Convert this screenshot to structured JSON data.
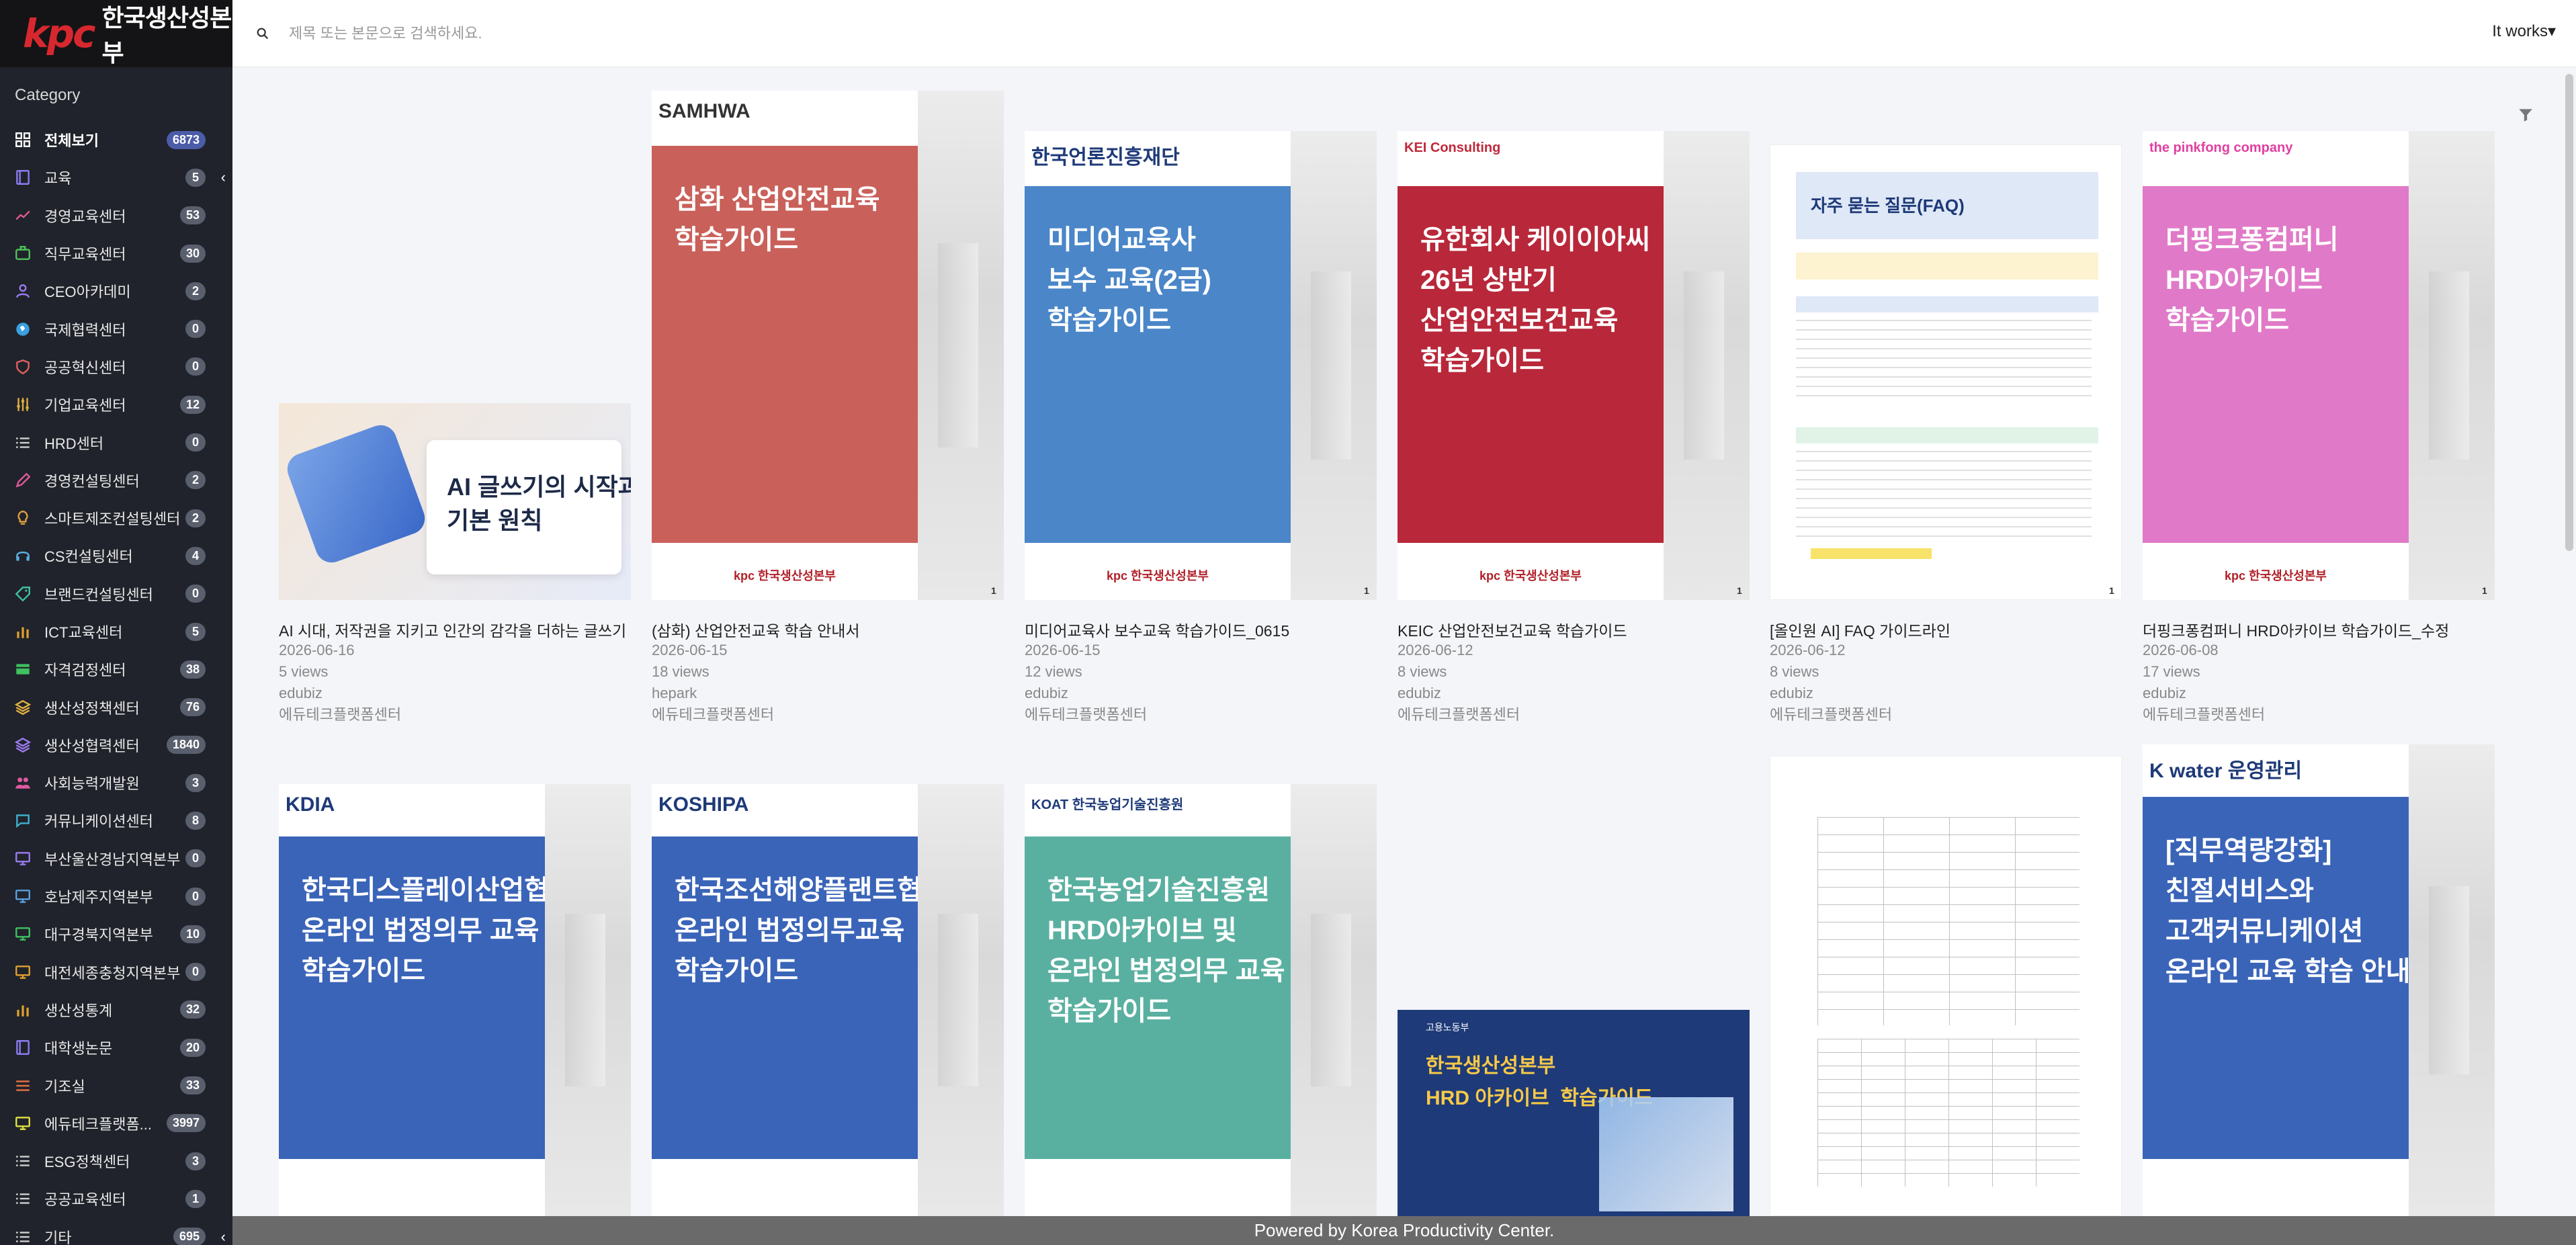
{
  "brand": {
    "mark": "kpc",
    "name": "한국생산성본부"
  },
  "sidebar": {
    "category_title": "Category",
    "items": [
      {
        "label": "전체보기",
        "count": "6873",
        "icon": "grid-icon",
        "color": "#ffffff"
      },
      {
        "label": "교육",
        "count": "5",
        "icon": "book-icon",
        "color": "#8a7cf0"
      },
      {
        "label": "경영교육센터",
        "count": "53",
        "icon": "chart-line-icon",
        "color": "#e05a8a"
      },
      {
        "label": "직무교육센터",
        "count": "30",
        "icon": "briefcase-icon",
        "color": "#4ec25a"
      },
      {
        "label": "CEO아카데미",
        "count": "2",
        "icon": "user-icon",
        "color": "#9a7cf0"
      },
      {
        "label": "국제협력센터",
        "count": "0",
        "icon": "globe-icon",
        "color": "#3aa0e0"
      },
      {
        "label": "공공혁신센터",
        "count": "0",
        "icon": "shield-icon",
        "color": "#e06060"
      },
      {
        "label": "기업교육센터",
        "count": "12",
        "icon": "sliders-icon",
        "color": "#e0b040"
      },
      {
        "label": "HRD센터",
        "count": "0",
        "icon": "list-icon",
        "color": "#d0d0d0"
      },
      {
        "label": "경영컨설팅센터",
        "count": "2",
        "icon": "pen-icon",
        "color": "#e05a9a"
      },
      {
        "label": "스마트제조컨설팅센터",
        "count": "2",
        "icon": "bulb-icon",
        "color": "#e0a040"
      },
      {
        "label": "CS컨설팅센터",
        "count": "4",
        "icon": "headset-icon",
        "color": "#5ab0e0"
      },
      {
        "label": "브랜드컨설팅센터",
        "count": "0",
        "icon": "tag-icon",
        "color": "#40c0a0"
      },
      {
        "label": "ICT교육센터",
        "count": "5",
        "icon": "bar-chart-icon",
        "color": "#e0a030"
      },
      {
        "label": "자격검정센터",
        "count": "38",
        "icon": "card-icon",
        "color": "#40c060"
      },
      {
        "label": "생산성정책센터",
        "count": "76",
        "icon": "layers-icon",
        "color": "#e0b040"
      },
      {
        "label": "생산성협력센터",
        "count": "1840",
        "icon": "layers-icon",
        "color": "#9a7cf0"
      },
      {
        "label": "사회능력개발원",
        "count": "3",
        "icon": "users-icon",
        "color": "#e05aa0"
      },
      {
        "label": "커뮤니케이션센터",
        "count": "8",
        "icon": "chat-icon",
        "color": "#40b0d0"
      },
      {
        "label": "부산울산경남지역본부",
        "count": "0",
        "icon": "monitor-icon",
        "color": "#9a7cf0"
      },
      {
        "label": "호남제주지역본부",
        "count": "0",
        "icon": "monitor-icon",
        "color": "#5aa0e0"
      },
      {
        "label": "대구경북지역본부",
        "count": "10",
        "icon": "monitor-icon",
        "color": "#40c060"
      },
      {
        "label": "대전세종충청지역본부",
        "count": "0",
        "icon": "monitor-icon",
        "color": "#e0a030"
      },
      {
        "label": "생산성통계",
        "count": "32",
        "icon": "bar-chart-icon",
        "color": "#e0a030"
      },
      {
        "label": "대학생논문",
        "count": "20",
        "icon": "book-icon",
        "color": "#8a7cf0"
      },
      {
        "label": "기조실",
        "count": "33",
        "icon": "menu-icon",
        "color": "#e07040"
      },
      {
        "label": "에듀테크플랫폼...",
        "count": "3997",
        "icon": "monitor-icon",
        "color": "#e0e040"
      },
      {
        "label": "ESG정책센터",
        "count": "3",
        "icon": "list-icon",
        "color": "#d0d0d0"
      },
      {
        "label": "공공교육센터",
        "count": "1",
        "icon": "list-icon",
        "color": "#d0d0d0"
      },
      {
        "label": "기타",
        "count": "695",
        "icon": "list-icon",
        "color": "#d0d0d0"
      }
    ]
  },
  "header": {
    "search_placeholder": "제목 또는 본문으로 검색하세요.",
    "user_label": "It works",
    "user_caret": "▾"
  },
  "cards": [
    {
      "title": "AI 시대, 저작권을 지키고 인간의 감각을 더하는 글쓰기",
      "date": "2026-06-16",
      "views": "5 views",
      "author": "edubiz",
      "dept": "에듀테크플랫폼센터",
      "cover_text": "AI 글쓰기의 시작과\n기본 원칙",
      "logo": "",
      "color": "#e8ecf8",
      "foot": ""
    },
    {
      "title": "(삼화) 산업안전교육 학습 안내서",
      "date": "2026-06-15",
      "views": "18 views",
      "author": "hepark",
      "dept": "에듀테크플랫폼센터",
      "cover_text": "삼화 산업안전교육\n학습가이드",
      "logo": "SAMHWA",
      "color": "#c9605a",
      "foot": "kpc 한국생산성본부"
    },
    {
      "title": "미디어교육사 보수교육 학습가이드_0615",
      "date": "2026-06-15",
      "views": "12 views",
      "author": "edubiz",
      "dept": "에듀테크플랫폼센터",
      "cover_text": "미디어교육사\n보수 교육(2급)\n학습가이드",
      "logo": "한국언론진흥재단",
      "color": "#4a86c8",
      "foot": "kpc 한국생산성본부"
    },
    {
      "title": "KEIC 산업안전보건교육 학습가이드",
      "date": "2026-06-12",
      "views": "8 views",
      "author": "edubiz",
      "dept": "에듀테크플랫폼센터",
      "cover_text": "유한회사 케이이아씨\n26년 상반기\n산업안전보건교육\n학습가이드",
      "logo": "KEI Consulting",
      "color": "#b8283a",
      "foot": "kpc 한국생산성본부"
    },
    {
      "title": "[올인원 AI] FAQ 가이드라인",
      "date": "2026-06-12",
      "views": "8 views",
      "author": "edubiz",
      "dept": "에듀테크플랫폼센터",
      "cover_text": "자주 묻는 질문(FAQ)",
      "logo": "",
      "color": "#ffffff",
      "foot": ""
    },
    {
      "title": "더핑크퐁컴퍼니 HRD아카이브 학습가이드_수정",
      "date": "2026-06-08",
      "views": "17 views",
      "author": "edubiz",
      "dept": "에듀테크플랫폼센터",
      "cover_text": "더핑크퐁컴퍼니\nHRD아카이브\n학습가이드",
      "logo": "the pinkfong company",
      "color": "#e07ac8",
      "foot": "kpc 한국생산성본부"
    },
    {
      "title": "",
      "date": "",
      "views": "",
      "author": "",
      "dept": "",
      "cover_text": "한국디스플레이산업협회\n온라인 법정의무 교육\n학습가이드",
      "logo": "KDIA",
      "color": "#3a64b8",
      "foot": ""
    },
    {
      "title": "",
      "date": "",
      "views": "",
      "author": "",
      "dept": "",
      "cover_text": "한국조선해양플랜트협회\n온라인 법정의무교육\n학습가이드",
      "logo": "KOSHIPA",
      "color": "#3a64b8",
      "foot": ""
    },
    {
      "title": "",
      "date": "",
      "views": "",
      "author": "",
      "dept": "",
      "cover_text": "한국농업기술진흥원\nHRD아카이브 및\n온라인 법정의무 교육\n학습가이드",
      "logo": "KOAT 한국농업기술진흥원",
      "color": "#5ab0a0",
      "foot": ""
    },
    {
      "title": "",
      "date": "",
      "views": "",
      "author": "",
      "dept": "",
      "cover_text": "한국생산성본부\nHRD 아카이브  학습가이드",
      "logo": "고용노동부",
      "color": "#1e3a78",
      "foot": ""
    },
    {
      "title": "",
      "date": "",
      "views": "",
      "author": "",
      "dept": "",
      "cover_text": "",
      "logo": "",
      "color": "#ffffff",
      "foot": ""
    },
    {
      "title": "",
      "date": "",
      "views": "",
      "author": "",
      "dept": "",
      "cover_text": "[직무역량강화]\n친절서비스와\n고객커뮤니케이션\n온라인 교육 학습 안내서",
      "logo": "K water 운영관리",
      "color": "#3a64b8",
      "foot": ""
    }
  ],
  "footer": {
    "text": "Powered by Korea Productivity Center."
  }
}
